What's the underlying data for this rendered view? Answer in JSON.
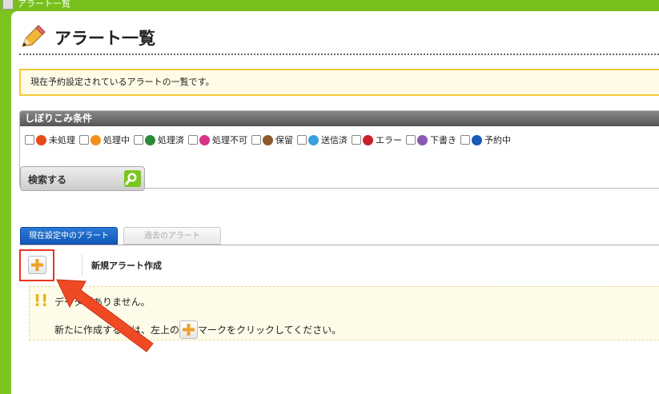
{
  "window": {
    "title": "アラート一覧"
  },
  "page": {
    "title": "アラート一覧",
    "notice": "現在予約設定されているアラートの一覧です。"
  },
  "filter": {
    "heading": "しぼりこみ条件",
    "statuses": [
      {
        "label": "未処理",
        "icon": "unprocessed-icon",
        "color": "#e84a1a"
      },
      {
        "label": "処理中",
        "icon": "processing-icon",
        "color": "#f0901a"
      },
      {
        "label": "処理済",
        "icon": "processed-icon",
        "color": "#2a8a3a"
      },
      {
        "label": "処理不可",
        "icon": "unprocessable-icon",
        "color": "#d8348a"
      },
      {
        "label": "保留",
        "icon": "pending-icon",
        "color": "#8a5a2a"
      },
      {
        "label": "送信済",
        "icon": "sent-icon",
        "color": "#3aa0e0"
      },
      {
        "label": "エラー",
        "icon": "error-icon",
        "color": "#c8202a"
      },
      {
        "label": "下書き",
        "icon": "draft-icon",
        "color": "#8a5ab0"
      },
      {
        "label": "予約中",
        "icon": "scheduled-icon",
        "color": "#1a5ab8"
      }
    ],
    "search_label": "検索する"
  },
  "tabs": [
    {
      "label": "現在設定中のアラート",
      "active": true
    },
    {
      "label": "過去のアラート",
      "active": false
    }
  ],
  "new_alert": {
    "label": "新規アラート作成"
  },
  "empty_state": {
    "line1": "データがありません。",
    "line2_pre": "新たに作成するには、左上の",
    "line2_post": "マークをクリックしてください。"
  },
  "colors": {
    "accent_green": "#7cc520",
    "tab_blue": "#1a66c8",
    "highlight_red": "#e8351e",
    "plus_orange": "#f0a028"
  }
}
